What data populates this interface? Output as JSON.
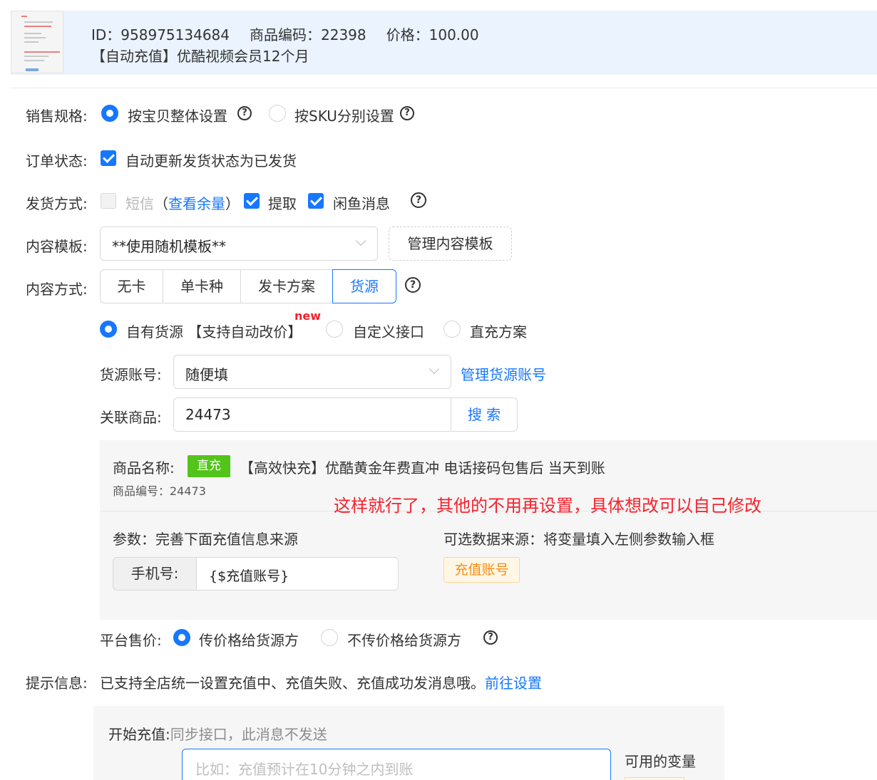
{
  "header": {
    "id_text": "ID：958975134684",
    "code_text": "商品编码：22398",
    "price_text": "价格：100.00",
    "product_title": "【自动充值】优酷视频会员12个月"
  },
  "sales_spec": {
    "label": "销售规格:",
    "option_whole": "按宝贝整体设置",
    "option_sku": "按SKU分别设置",
    "selected": "按宝贝整体设置"
  },
  "order_status": {
    "label": "订单状态:",
    "checkbox_label": "自动更新发货状态为已发货",
    "checked": true
  },
  "delivery": {
    "label": "发货方式:",
    "sms_label": "短信",
    "sms_paren_open": "（",
    "sms_link": "查看余量",
    "sms_paren_close": "）",
    "sms_checked": false,
    "pickup_label": "提取",
    "pickup_checked": true,
    "xianyu_label": "闲鱼消息",
    "xianyu_checked": true
  },
  "content_template": {
    "label": "内容模板:",
    "selected": "**使用随机模板**",
    "manage_button": "管理内容模板"
  },
  "content_mode": {
    "label": "内容方式:",
    "options": [
      "无卡",
      "单卡种",
      "发卡方案",
      "货源"
    ],
    "active": "货源"
  },
  "source_type": {
    "own_source": "自有货源",
    "own_source_note": "【支持自动改价】",
    "new_badge": "new",
    "custom_api": "自定义接口",
    "direct_plan": "直充方案",
    "selected": "自有货源"
  },
  "source_account": {
    "label": "货源账号:",
    "selected": "随便填",
    "manage_link": "管理货源账号"
  },
  "linked_product": {
    "label": "关联商品:",
    "value": "24473",
    "search_button": "搜 索"
  },
  "product_panel": {
    "name_label": "商品名称:",
    "tag": "直充",
    "name": "【高效快充】优酷黄金年费直冲 电话接码包售后 当天到账",
    "code_text": "商品编号：24473",
    "note": "这样就行了，其他的不用再设置，具体想改可以自己修改",
    "params_title": "参数：完善下面充值信息来源",
    "sources_title": "可选数据来源：将变量填入左侧参数输入框",
    "param_name": "手机号:",
    "param_value": "{$充值账号}",
    "source_tag": "充值账号"
  },
  "platform_price": {
    "label": "平台售价:",
    "option_pass": "传价格给货源方",
    "option_no_pass": "不传价格给货源方",
    "selected": "传价格给货源方"
  },
  "tip_info": {
    "label": "提示信息:",
    "text": "已支持全店统一设置充值中、充值失败、充值成功发消息哦。",
    "link": "前往设置"
  },
  "start_recharge": {
    "label": "开始充值:",
    "note": "同步接口，此消息不发送",
    "placeholder": "比如：充值预计在10分钟之内到账",
    "vars_label": "可用的变量"
  },
  "colors": {
    "primary": "#1677ff",
    "header_bg": "#eaf3fe",
    "green_tag": "#52c41a",
    "red_note": "#f5222d",
    "orange_tag": "#fa8c16"
  }
}
